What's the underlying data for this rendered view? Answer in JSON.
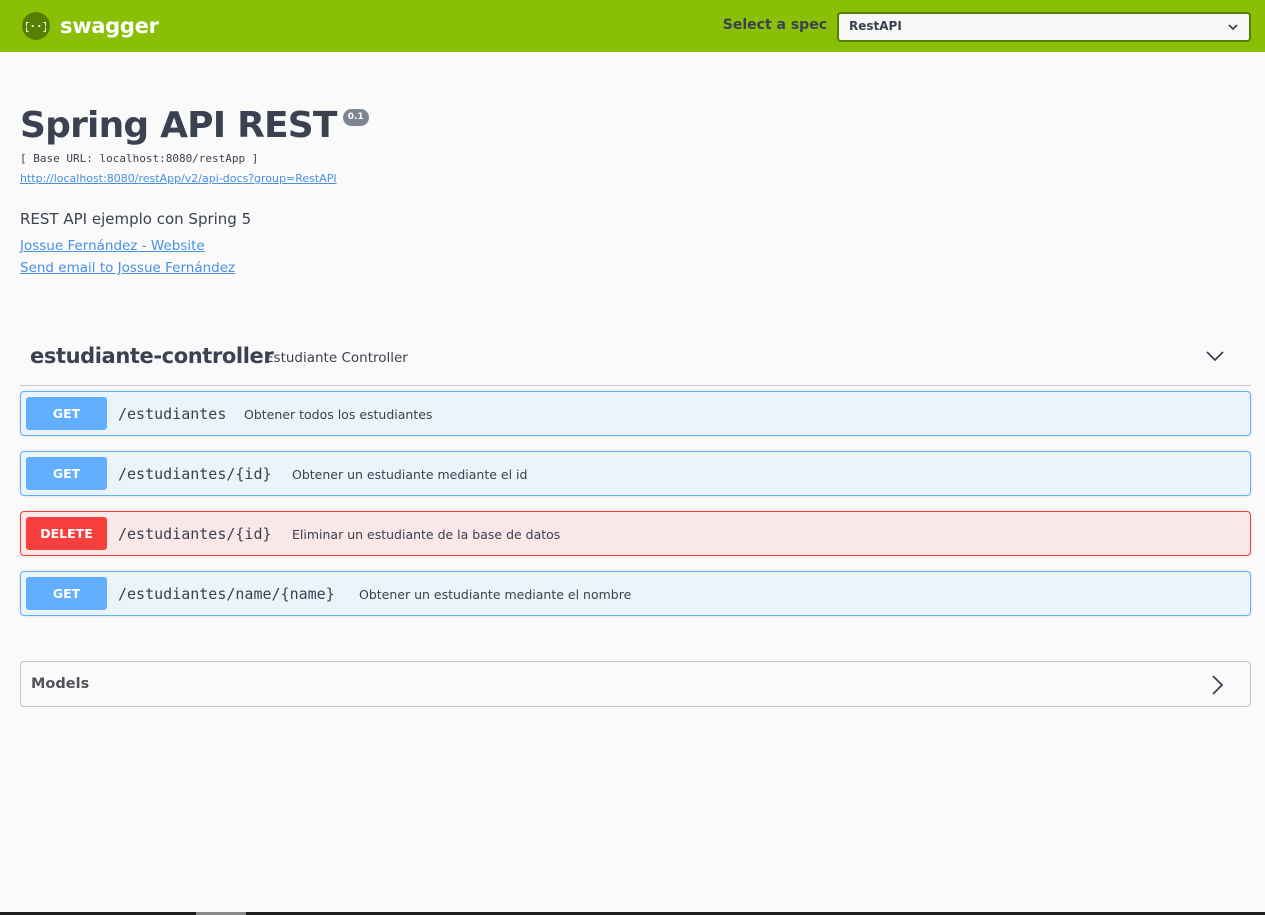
{
  "topbar": {
    "logo_text": "swagger",
    "logo_icon": "swagger-braces-icon",
    "spec_label": "Select a spec",
    "spec_selected": "RestAPI",
    "brand_color": "#89bf04"
  },
  "info": {
    "title": "Spring API REST",
    "version": "0.1",
    "base_url": "[ Base URL: localhost:8080/restApp ]",
    "api_docs_url": "http://localhost:8080/restApp/v2/api-docs?group=RestAPI",
    "description": "REST API ejemplo con Spring 5",
    "contact_website": "Jossue Fernández - Website",
    "contact_email": "Send email to Jossue Fernández"
  },
  "tag": {
    "name": "estudiante-controller",
    "description": "Estudiante Controller",
    "expanded": true
  },
  "operations": [
    {
      "method": "GET",
      "path": "/estudiantes",
      "summary": "Obtener todos los estudiantes",
      "color": "#61affe"
    },
    {
      "method": "GET",
      "path": "/estudiantes/{id}",
      "summary": "Obtener un estudiante mediante el id",
      "color": "#61affe"
    },
    {
      "method": "DELETE",
      "path": "/estudiantes/{id}",
      "summary": "Eliminar un estudiante de la base de datos",
      "color": "#f93e3e"
    },
    {
      "method": "GET",
      "path": "/estudiantes/name/{name}",
      "summary": "Obtener un estudiante mediante el nombre",
      "color": "#61affe"
    }
  ],
  "models": {
    "label": "Models",
    "expanded": false
  }
}
